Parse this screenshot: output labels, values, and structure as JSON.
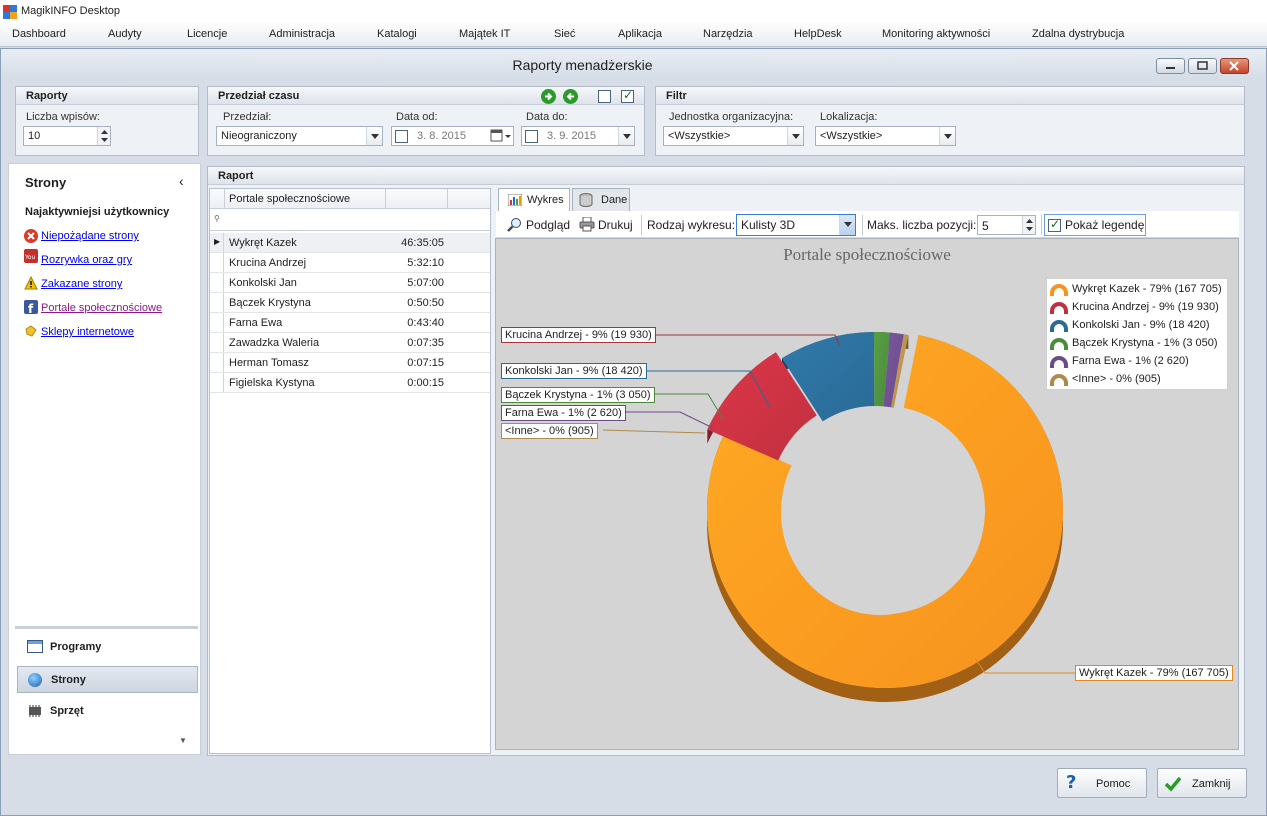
{
  "app": {
    "title": "MagikINFO Desktop"
  },
  "menu": [
    "Dashboard",
    "Audyty",
    "Licencje",
    "Administracja",
    "Katalogi",
    "Majątek IT",
    "Sieć",
    "Aplikacja",
    "Narzędzia",
    "HelpDesk",
    "Monitoring aktywności",
    "Zdalna dystrybucja"
  ],
  "window": {
    "title": "Raporty menadżerskie"
  },
  "raporty": {
    "header": "Raporty",
    "count_label": "Liczba wpisów:",
    "count_value": "10"
  },
  "przedzial": {
    "header": "Przedział czasu",
    "range_label": "Przedział:",
    "range_value": "Nieograniczony",
    "from_label": "Data od:",
    "from_value": "3.  8. 2015",
    "to_label": "Data do:",
    "to_value": "3.  9. 2015"
  },
  "filtr": {
    "header": "Filtr",
    "unit_label": "Jednostka organizacyjna:",
    "unit_value": "<Wszystkie>",
    "loc_label": "Lokalizacja:",
    "loc_value": "<Wszystkie>"
  },
  "leftnav": {
    "title": "Strony",
    "section": "Najaktywniejsi użytkownicy",
    "links": [
      "Niepożądane strony",
      "Rozrywka oraz gry",
      "Zakazane strony",
      "Portale społecznościowe",
      "Sklepy internetowe"
    ],
    "bottom": [
      "Programy",
      "Strony",
      "Sprzęt"
    ]
  },
  "report": {
    "header": "Raport",
    "column": "Portale społecznościowe",
    "rows": [
      {
        "name": "Wykręt Kazek",
        "value": "46:35:05"
      },
      {
        "name": "Krucina Andrzej",
        "value": "5:32:10"
      },
      {
        "name": "Konkolski Jan",
        "value": "5:07:00"
      },
      {
        "name": "Bączek Krystyna",
        "value": "0:50:50"
      },
      {
        "name": "Farna Ewa",
        "value": "0:43:40"
      },
      {
        "name": "Zawadzka Waleria",
        "value": "0:07:35"
      },
      {
        "name": "Herman Tomasz",
        "value": "0:07:15"
      },
      {
        "name": "Figielska Kystyna",
        "value": "0:00:15"
      }
    ]
  },
  "tabs": {
    "chart": "Wykres",
    "data": "Dane"
  },
  "toolbar": {
    "preview": "Podgląd",
    "print": "Drukuj",
    "type_label": "Rodzaj wykresu:",
    "type_value": "Kulisty 3D",
    "max_label": "Maks. liczba pozycji:",
    "max_value": "5",
    "legend_label": "Pokaż legendę"
  },
  "chart_data": {
    "type": "pie",
    "title": "Portale społecznościowe",
    "labels": [
      "Wykręt Kazek - 79% (167 705)",
      "Krucina Andrzej - 9% (19 930)",
      "Konkolski Jan - 9% (18 420)",
      "Bączek Krystyna - 1% (3 050)",
      "Farna Ewa - 1% (2 620)",
      "<Inne> - 0% (905)"
    ],
    "values": [
      167705,
      19930,
      18420,
      3050,
      2620,
      905
    ],
    "colors": [
      "#f7931e",
      "#c0303f",
      "#2a6a95",
      "#4c8a3c",
      "#6a4c8a",
      "#b08a4c"
    ],
    "legend": "top-right"
  },
  "buttons": {
    "help": "Pomoc",
    "close": "Zamknij"
  }
}
